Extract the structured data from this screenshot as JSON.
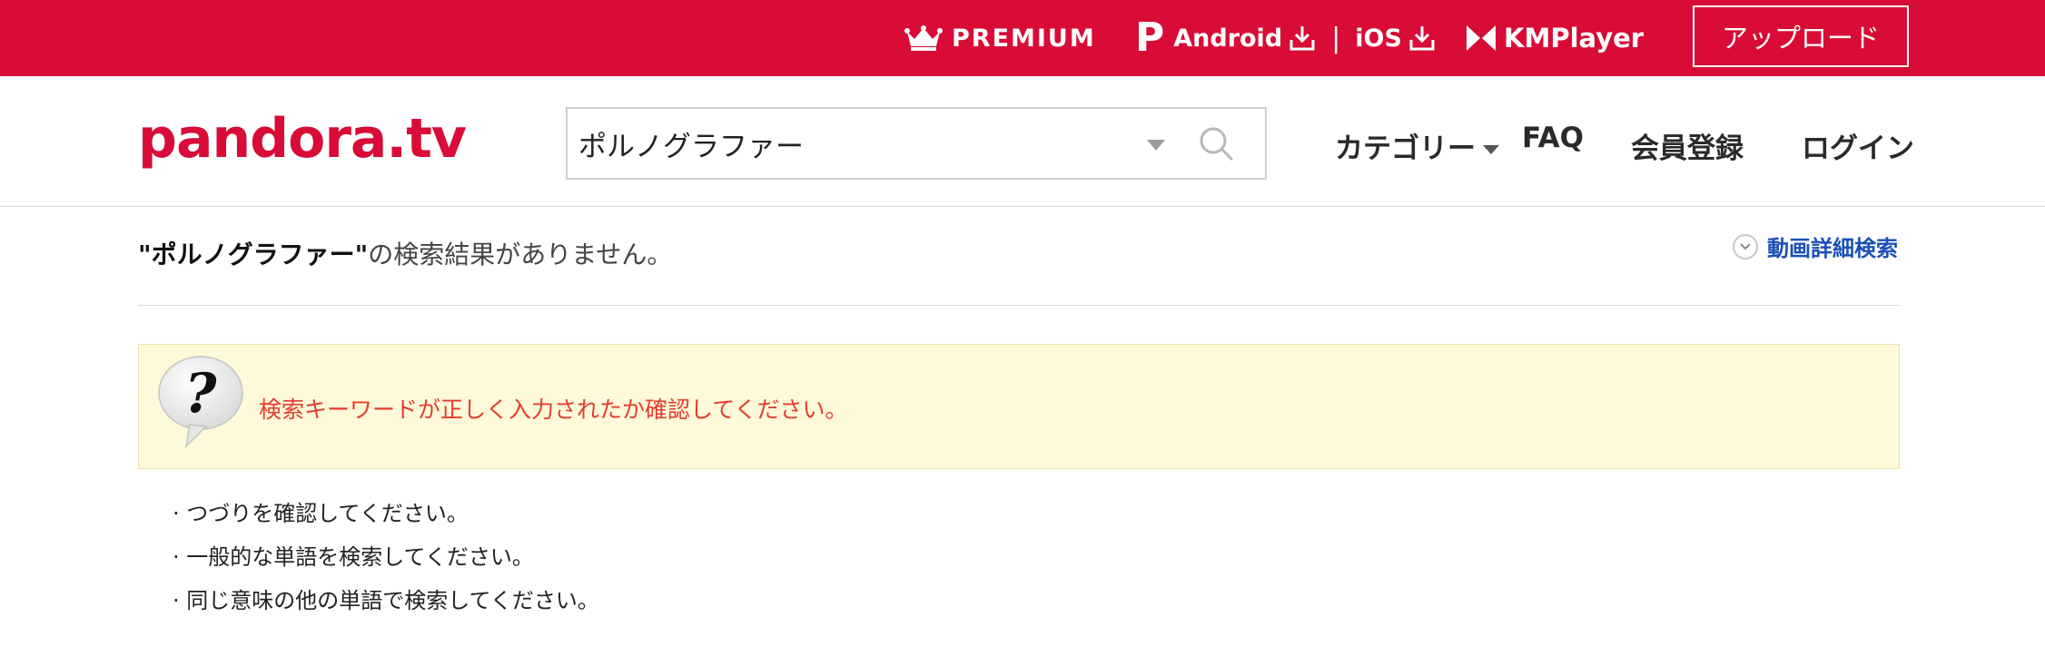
{
  "topbar": {
    "premium_label": "PREMIUM",
    "premium_icon": "crown-icon",
    "android_label": "Android",
    "ios_label": "iOS",
    "separator": "|",
    "p_mark": "P",
    "kmplayer_label": "KMPlayer",
    "upload_label": "アップロード",
    "bg_color": "#d80c36"
  },
  "header": {
    "logo_text": "pandora.tv",
    "search": {
      "value": "ポルノグラファー",
      "placeholder": ""
    },
    "nav": {
      "category": "カテゴリー",
      "faq": "FAQ",
      "join": "会員登録",
      "login": "ログイン"
    }
  },
  "main": {
    "result_keyword": "\"ポルノグラファー\"",
    "result_suffix": "の検索結果がありません。",
    "advanced_search_label": "動画詳細検索",
    "notice_text": "検索キーワードが正しく入力されたか確認してください。",
    "tips": [
      "· つづりを確認してください。",
      "· 一般的な単語を検索してください。",
      "· 同じ意味の他の単語で検索してください。"
    ]
  },
  "colors": {
    "brand_red": "#d80c36",
    "link_blue": "#1b4fb6",
    "notice_bg": "#fef9d8",
    "notice_text": "#e33d2e"
  }
}
